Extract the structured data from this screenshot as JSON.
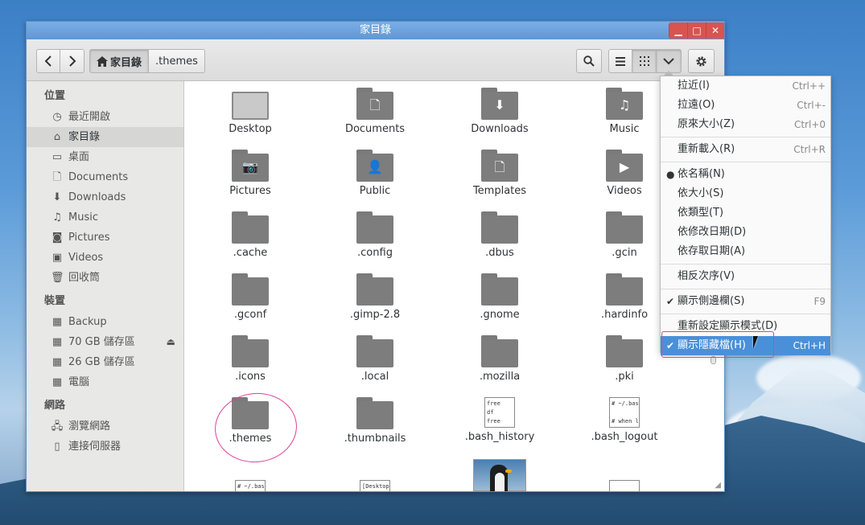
{
  "window": {
    "title": "家目錄"
  },
  "wm": {
    "minimize": "▁",
    "maximize": "□",
    "close": "✕"
  },
  "toolbar": {
    "back_icon": "chevron-left-icon",
    "forward_icon": "chevron-right-icon",
    "path_home": "家目錄",
    "path_current": ".themes",
    "search_icon": "search-icon",
    "list_view_icon": "list-view-icon",
    "grid_view_icon": "grid-view-icon",
    "view_menu_icon": "chevron-down-icon",
    "settings_icon": "gear-icon"
  },
  "sidebar": {
    "sections": {
      "places": "位置",
      "devices": "裝置",
      "network": "網路"
    },
    "places": [
      {
        "label": "最近開啟",
        "icon": "clock-icon"
      },
      {
        "label": "家目錄",
        "icon": "home-icon"
      },
      {
        "label": "桌面",
        "icon": "desktop-icon"
      },
      {
        "label": "Documents",
        "icon": "document-icon"
      },
      {
        "label": "Downloads",
        "icon": "download-icon"
      },
      {
        "label": "Music",
        "icon": "headphones-icon"
      },
      {
        "label": "Pictures",
        "icon": "camera-icon"
      },
      {
        "label": "Videos",
        "icon": "film-icon"
      },
      {
        "label": "回收筒",
        "icon": "trash-icon"
      }
    ],
    "devices": [
      {
        "label": "Backup",
        "icon": "drive-icon"
      },
      {
        "label": "70 GB 儲存區",
        "icon": "drive-icon"
      },
      {
        "label": "26 GB 儲存區",
        "icon": "drive-icon"
      },
      {
        "label": "電腦",
        "icon": "drive-icon"
      }
    ],
    "network": [
      {
        "label": "瀏覽網路",
        "icon": "network-icon"
      },
      {
        "label": "連接伺服器",
        "icon": "server-icon"
      }
    ]
  },
  "files": [
    {
      "name": "Desktop",
      "kind": "desktop"
    },
    {
      "name": "Documents",
      "kind": "folder",
      "glyph": "🗋"
    },
    {
      "name": "Downloads",
      "kind": "folder",
      "glyph": "⬇"
    },
    {
      "name": "Music",
      "kind": "folder",
      "glyph": "♫"
    },
    {
      "name": "Pictures",
      "kind": "folder",
      "glyph": "📷"
    },
    {
      "name": "Public",
      "kind": "folder",
      "glyph": "👤"
    },
    {
      "name": "Templates",
      "kind": "folder",
      "glyph": "🗋"
    },
    {
      "name": "Videos",
      "kind": "folder",
      "glyph": "▶"
    },
    {
      "name": ".cache",
      "kind": "folder"
    },
    {
      "name": ".config",
      "kind": "folder"
    },
    {
      "name": ".dbus",
      "kind": "folder"
    },
    {
      "name": ".gcin",
      "kind": "folder"
    },
    {
      "name": ".gconf",
      "kind": "folder"
    },
    {
      "name": ".gimp-2.8",
      "kind": "folder"
    },
    {
      "name": ".gnome",
      "kind": "folder"
    },
    {
      "name": ".hardinfo",
      "kind": "folder"
    },
    {
      "name": ".icons",
      "kind": "folder"
    },
    {
      "name": ".local",
      "kind": "folder"
    },
    {
      "name": ".mozilla",
      "kind": "folder"
    },
    {
      "name": ".pki",
      "kind": "folder"
    },
    {
      "name": ".themes",
      "kind": "folder"
    },
    {
      "name": ".thumbnails",
      "kind": "folder"
    },
    {
      "name": ".bash_history",
      "kind": "text",
      "preview": "free\ndf\nfree"
    },
    {
      "name": ".bash_logout",
      "kind": "text",
      "preview": "# ~/.bash_\n\n# when le"
    }
  ],
  "partial_row": [
    {
      "preview": "# ~/.bashr",
      "kind": "text"
    },
    {
      "preview": "[Desktop]",
      "kind": "text"
    },
    {
      "kind": "image"
    },
    {
      "preview": "",
      "kind": "text"
    }
  ],
  "menu": {
    "items": [
      {
        "label": "拉近(I)",
        "accel": "Ctrl++"
      },
      {
        "label": "拉遠(O)",
        "accel": "Ctrl+-"
      },
      {
        "label": "原來大小(Z)",
        "accel": "Ctrl+0"
      },
      {
        "sep": true
      },
      {
        "label": "重新載入(R)",
        "accel": "Ctrl+R"
      },
      {
        "sep": true
      },
      {
        "label": "依名稱(N)",
        "mark": "●"
      },
      {
        "label": "依大小(S)"
      },
      {
        "label": "依類型(T)"
      },
      {
        "label": "依修改日期(D)"
      },
      {
        "label": "依存取日期(A)"
      },
      {
        "sep": true
      },
      {
        "label": "相反次序(V)"
      },
      {
        "sep": true
      },
      {
        "label": "顯示側邊欄(S)",
        "accel": "F9",
        "mark": "✔"
      },
      {
        "sep": true
      },
      {
        "label": "重新設定顯示模式(D)"
      },
      {
        "label": "顯示隱藏檔(H)",
        "accel": "Ctrl+H",
        "mark": "✔",
        "highlighted": true
      }
    ]
  }
}
